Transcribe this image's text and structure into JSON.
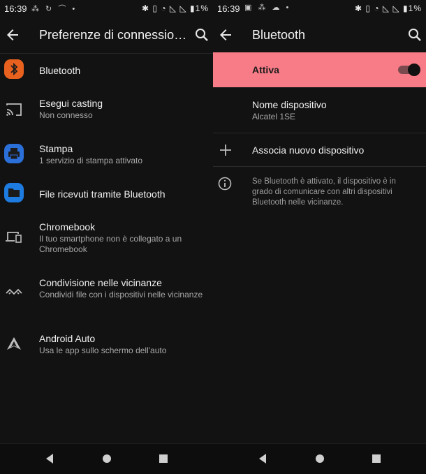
{
  "left": {
    "status": {
      "time": "16:39",
      "battery": "1%"
    },
    "toolbar": {
      "title": "Preferenze di connessio…"
    },
    "items": [
      {
        "title": "Bluetooth"
      },
      {
        "title": "Esegui casting",
        "subtitle": "Non connesso"
      },
      {
        "title": "Stampa",
        "subtitle": "1 servizio di stampa attivato"
      },
      {
        "title": "File ricevuti tramite Bluetooth"
      },
      {
        "title": "Chromebook",
        "subtitle": "Il tuo smartphone non è collegato a un Chromebook"
      },
      {
        "title": "Condivisione nelle vicinanze",
        "subtitle": "Condividi file con i dispositivi nelle vicinanze"
      },
      {
        "title": "Android Auto",
        "subtitle": "Usa le app sullo schermo dell'auto"
      }
    ]
  },
  "right": {
    "status": {
      "time": "16:39",
      "battery": "1%"
    },
    "toolbar": {
      "title": "Bluetooth"
    },
    "toggle": {
      "label": "Attiva",
      "on": true
    },
    "device_name": {
      "title": "Nome dispositivo",
      "value": "Alcatel 1SE"
    },
    "pair": {
      "label": "Associa nuovo dispositivo"
    },
    "info": {
      "text": "Se Bluetooth è attivato, il dispositivo è in grado di comunicare con altri dispositivi Bluetooth nelle vicinanze."
    }
  },
  "colors": {
    "accent_row": "#f87c87",
    "bluetooth_icon": "#e8611f",
    "print_icon": "#2b6fd8",
    "folder_icon": "#1e7be0"
  }
}
